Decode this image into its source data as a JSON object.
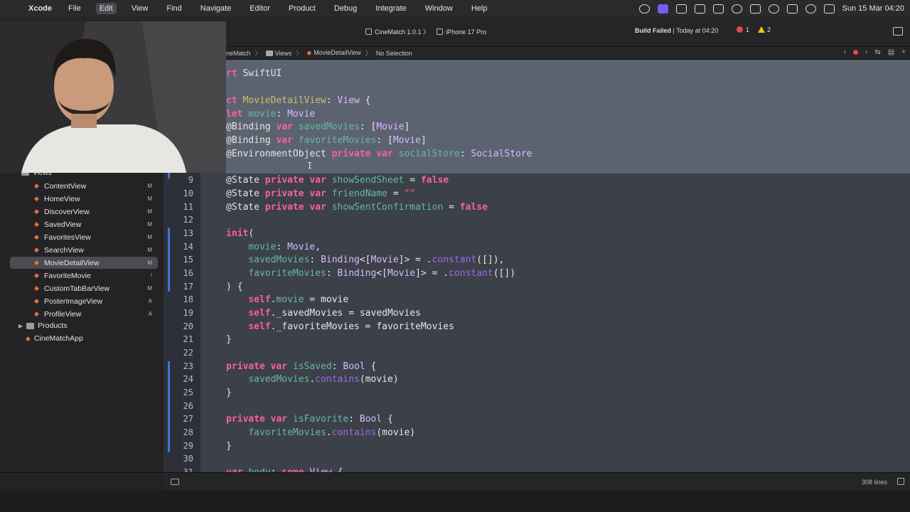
{
  "menubar": {
    "app": "Xcode",
    "items": [
      "File",
      "Edit",
      "View",
      "Find",
      "Navigate",
      "Editor",
      "Product",
      "Debug",
      "Integrate",
      "Window",
      "Help"
    ],
    "active_item": "Edit",
    "clock": "Sun 15 Mar  04:20"
  },
  "toolbar": {
    "scheme": "CineMatch 1.0.1",
    "destination": "iPhone 17 Pro",
    "build_status": "Build Failed",
    "build_time": "Today at 04:20",
    "errors": "1",
    "warnings": "2"
  },
  "jumpbar": {
    "project": "neMatch",
    "group": "Views",
    "file": "MovieDetailView",
    "selection": "No Selection"
  },
  "navigator": {
    "group": "Views",
    "files": [
      {
        "name": "ContentView",
        "badge": "M"
      },
      {
        "name": "HomeView",
        "badge": "M"
      },
      {
        "name": "DiscoverView.",
        "badge": "M"
      },
      {
        "name": "SavedView",
        "badge": "M"
      },
      {
        "name": "FavoritesView",
        "badge": "M"
      },
      {
        "name": "SearchView",
        "badge": "M"
      },
      {
        "name": "MovieDetailView",
        "badge": "M"
      },
      {
        "name": "FavoriteMovie",
        "badge": "!"
      },
      {
        "name": "CustomTabBarView",
        "badge": "M"
      },
      {
        "name": "PosterImageView",
        "badge": "A"
      },
      {
        "name": "ProfileView",
        "badge": "A"
      }
    ],
    "selected": "MovieDetailView",
    "products": "Products",
    "app_target": "CineMatchApp"
  },
  "editor": {
    "line_numbers": [
      "9",
      "10",
      "11",
      "12",
      "13",
      "14",
      "15",
      "16",
      "17",
      "18",
      "19",
      "20",
      "21",
      "22",
      "23",
      "24",
      "25",
      "26",
      "27",
      "28",
      "29",
      "30",
      "31"
    ],
    "line_count": "308 lines"
  }
}
